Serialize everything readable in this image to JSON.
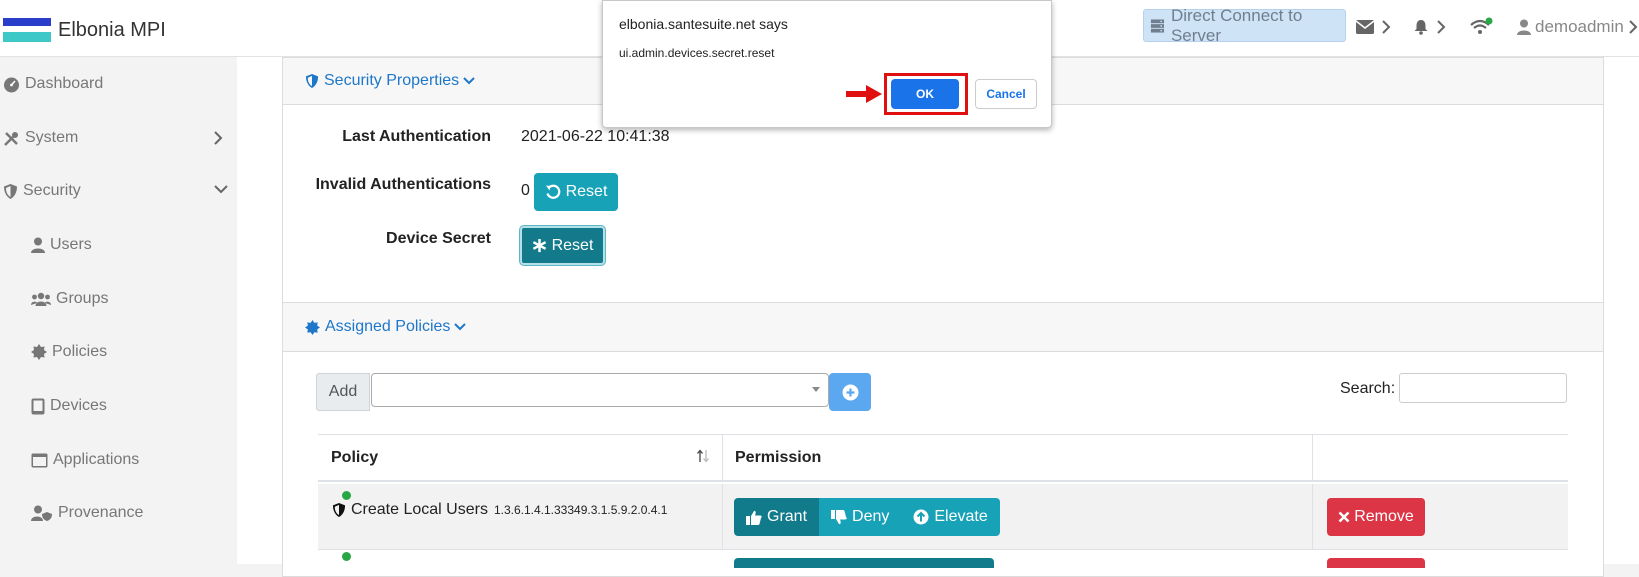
{
  "app": {
    "name": "Elbonia MPI",
    "flag_colors": [
      "#2b3ec9",
      "#ffffff",
      "#3fc8c8"
    ]
  },
  "topbar": {
    "direct_connect": "Direct Connect to Server",
    "user": "demoadmin"
  },
  "sidebar": {
    "items": [
      {
        "label": "Dashboard",
        "icon": "dashboard-icon"
      },
      {
        "label": "System",
        "icon": "tools-icon"
      },
      {
        "label": "Security",
        "icon": "shield-icon"
      },
      {
        "label": "Users",
        "icon": "user-icon"
      },
      {
        "label": "Groups",
        "icon": "users-icon"
      },
      {
        "label": "Policies",
        "icon": "certificate-icon"
      },
      {
        "label": "Devices",
        "icon": "tablet-icon"
      },
      {
        "label": "Applications",
        "icon": "window-icon"
      },
      {
        "label": "Provenance",
        "icon": "user-shield-icon"
      }
    ]
  },
  "security_properties": {
    "heading": "Security Properties",
    "last_auth_label": "Last Authentication",
    "last_auth_value": "2021-06-22 10:41:38",
    "invalid_auth_label": "Invalid Authentications",
    "invalid_auth_value": "0",
    "reset_label": "Reset",
    "device_secret_label": "Device Secret",
    "device_secret_reset": "Reset"
  },
  "assigned_policies": {
    "heading": "Assigned Policies",
    "add_label": "Add",
    "search_label": "Search:",
    "columns": [
      "Policy",
      "Permission"
    ],
    "rows": [
      {
        "name": "Create Local Users",
        "oid": "1.3.6.1.4.1.33349.3.1.5.9.2.0.4.1",
        "grant": "Grant",
        "deny": "Deny",
        "elevate": "Elevate",
        "remove": "Remove"
      }
    ]
  },
  "dialog": {
    "title": "elbonia.santesuite.net says",
    "message": "ui.admin.devices.secret.reset",
    "ok": "OK",
    "cancel": "Cancel"
  },
  "colors": {
    "accent_blue": "#1e77c9",
    "teal": "#17a2b8",
    "teal_dark": "#117a8b",
    "danger": "#dc3545",
    "dialog_ok": "#1a73e8",
    "highlight_red": "#e01010"
  }
}
